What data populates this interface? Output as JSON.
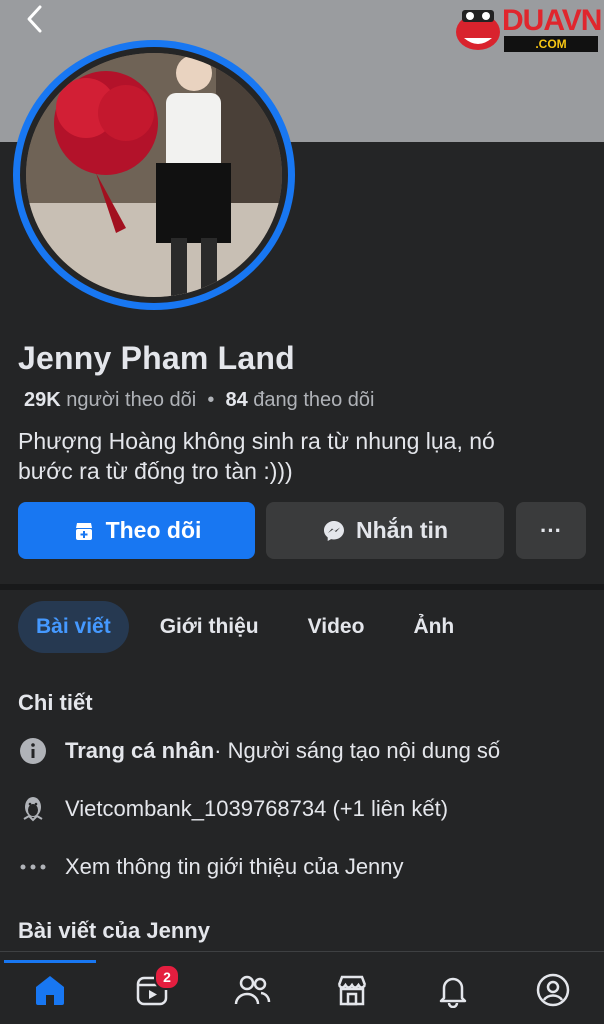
{
  "logo": {
    "text": "DUAVN",
    "sub": ".COM"
  },
  "profile": {
    "name": "Jenny Pham Land",
    "followers_count": "29K",
    "followers_label": "người theo dõi",
    "separator": "•",
    "following_count": "84",
    "following_label": "đang theo dõi",
    "bio_line1": "Phượng Hoàng không sinh ra từ nhung lụa, nó",
    "bio_line2": "bước ra từ đống tro tàn :)))"
  },
  "actions": {
    "follow_label": "Theo dõi",
    "message_label": "Nhắn tin",
    "more_label": "···"
  },
  "tabs": [
    {
      "label": "Bài viết",
      "active": true
    },
    {
      "label": "Giới thiệu",
      "active": false
    },
    {
      "label": "Video",
      "active": false
    },
    {
      "label": "Ảnh",
      "active": false
    }
  ],
  "details": {
    "title": "Chi tiết",
    "page_type_bold": "Trang cá nhân",
    "page_type_rest": " · Người sáng tạo nội dung số",
    "link_text": "Vietcombank_1039768734 (+1 liên kết)",
    "see_about": "Xem thông tin giới thiệu của Jenny"
  },
  "posts_title": "Bài viết của Jenny",
  "nav": {
    "video_badge": "2",
    "icons": [
      "home-icon",
      "video-icon",
      "friends-icon",
      "marketplace-icon",
      "notifications-icon",
      "profile-icon"
    ]
  },
  "colors": {
    "accent": "#1877f2",
    "background": "#242526",
    "badge": "#e41e3f"
  }
}
